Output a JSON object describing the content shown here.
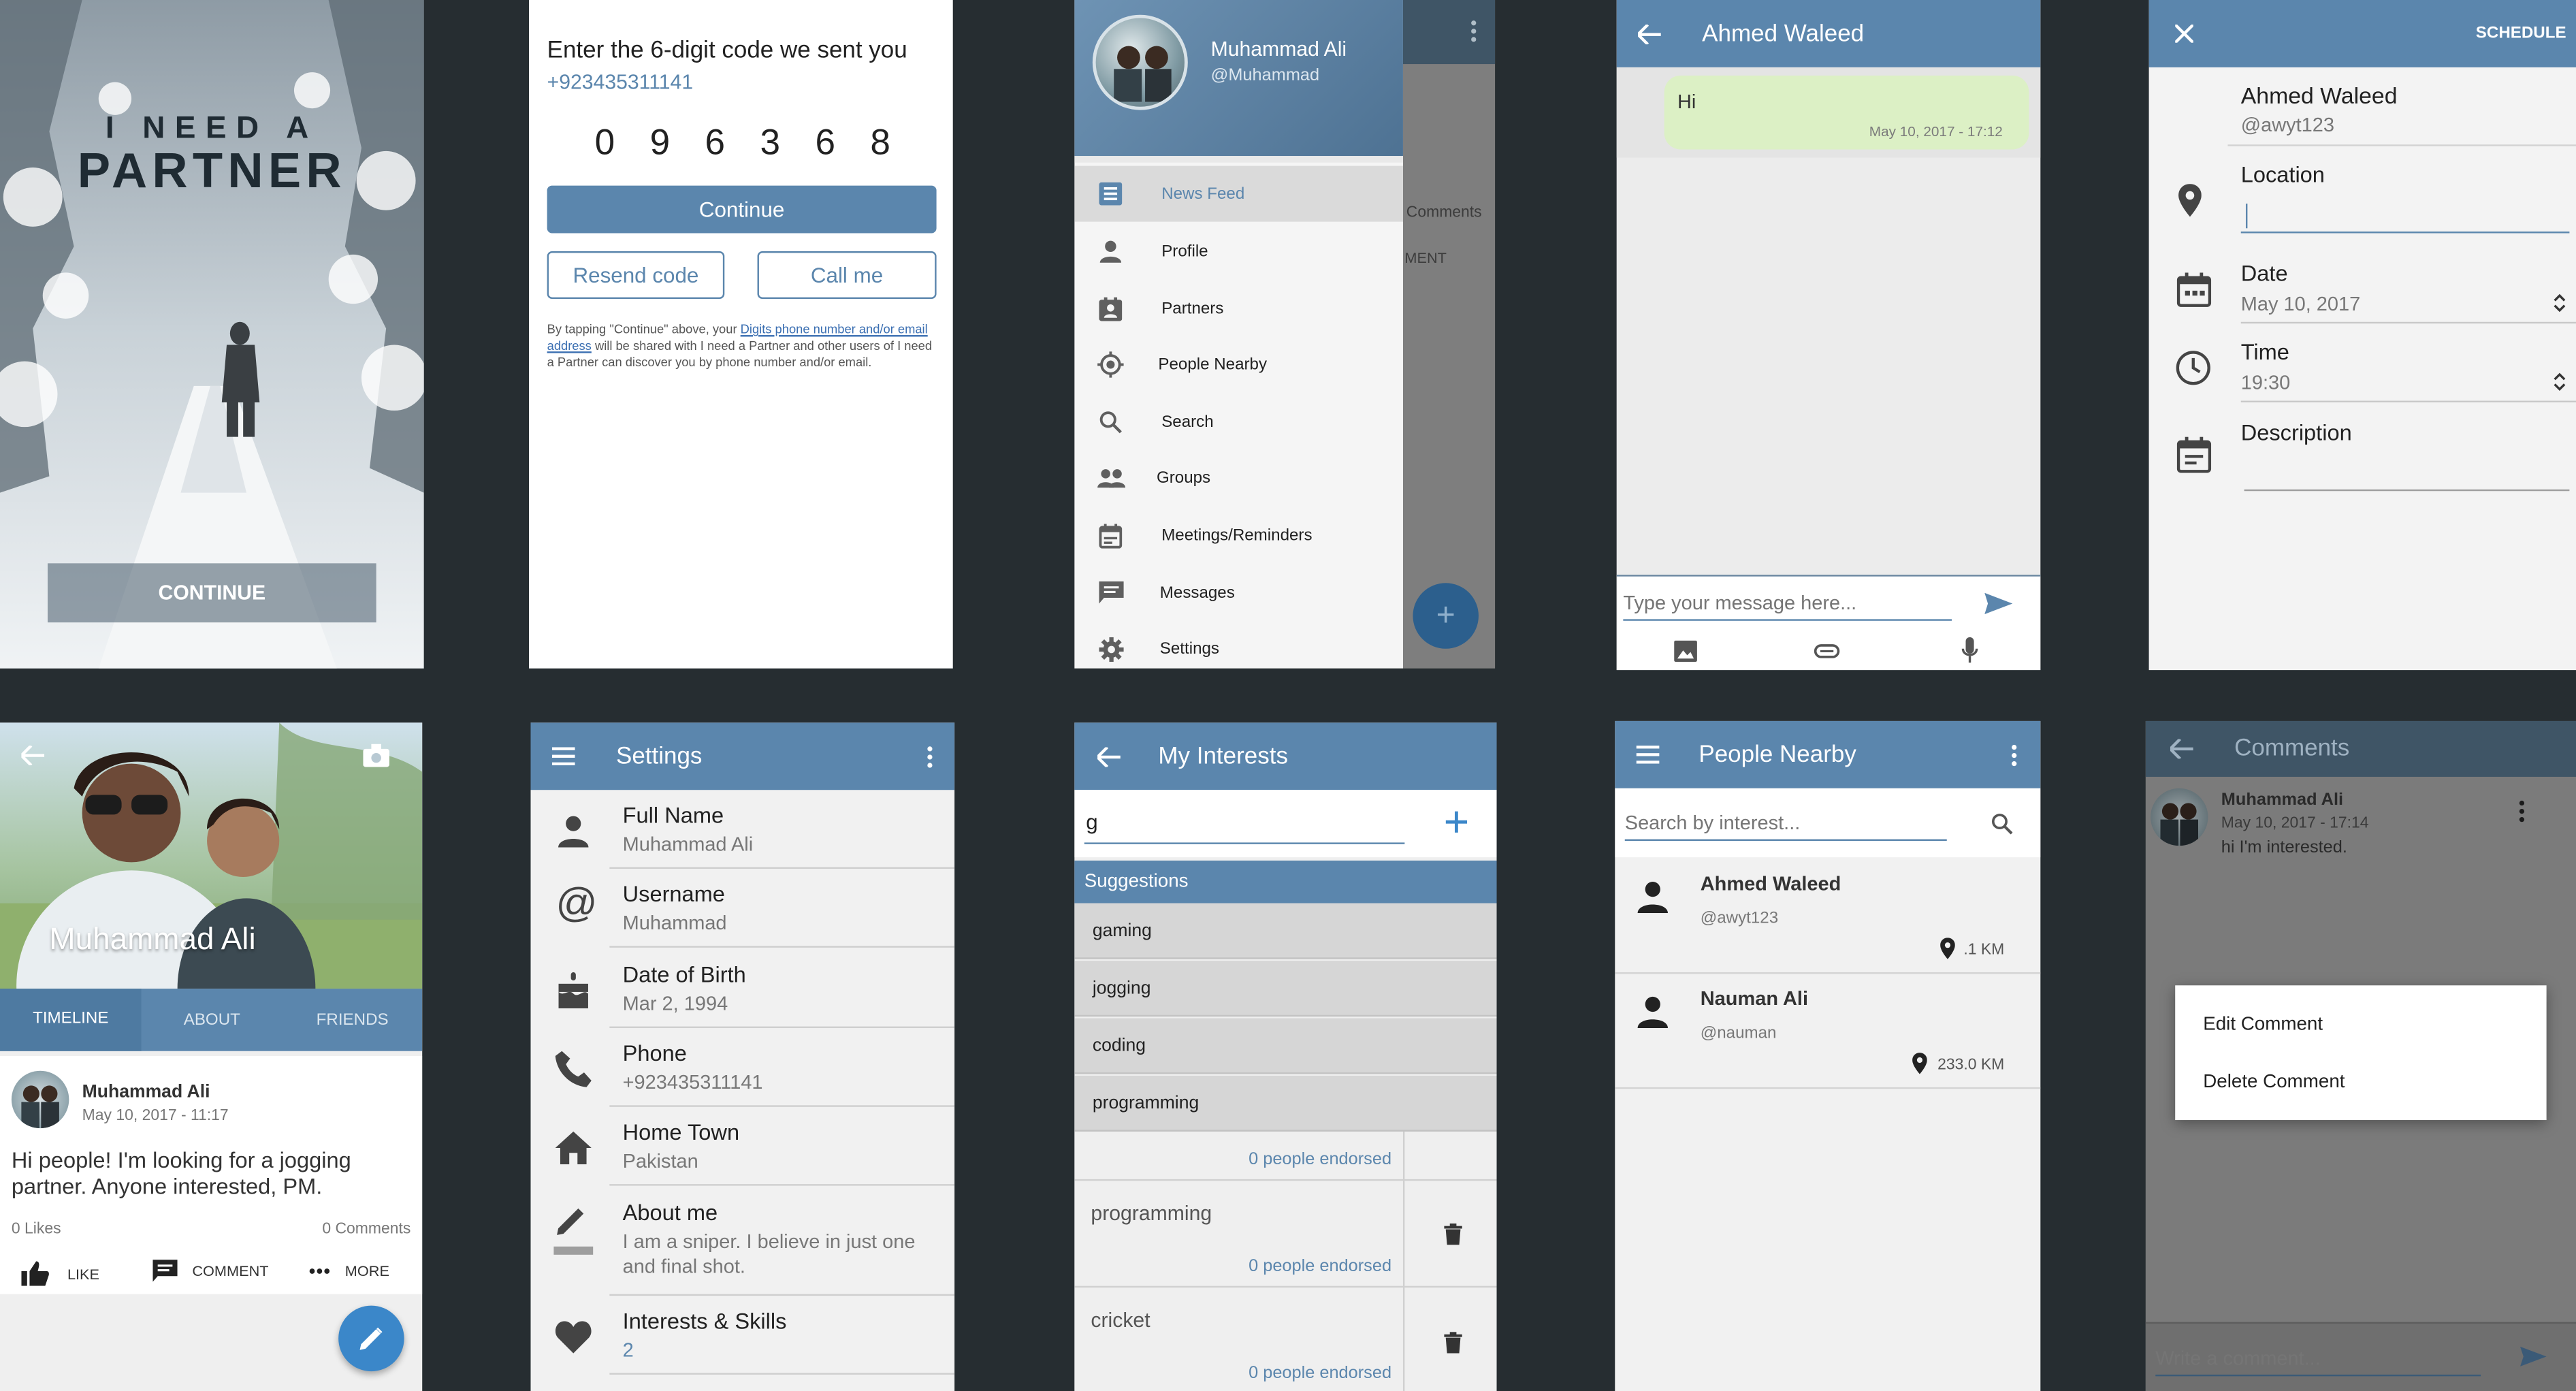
{
  "splash": {
    "logo_line1": "I NEED A",
    "logo_line2": "PARTNER",
    "continue_label": "CONTINUE"
  },
  "verify": {
    "heading": "Enter the 6-digit code we sent you",
    "phone": "+923435311141",
    "code_digits": [
      "0",
      "9",
      "6",
      "3",
      "6",
      "8"
    ],
    "continue_label": "Continue",
    "resend_label": "Resend code",
    "call_label": "Call me",
    "disclaimer_pre": "By tapping \"Continue\" above, your ",
    "disclaimer_link": "Digits phone number and/or email address",
    "disclaimer_post": " will be shared with I need a Partner and other users of I need a Partner can discover you by phone number and/or email."
  },
  "drawer": {
    "user_name": "Muhammad Ali",
    "user_handle": "@Muhammad",
    "items": [
      {
        "label": "News Feed",
        "icon": "news-feed-icon"
      },
      {
        "label": "Profile",
        "icon": "person-icon"
      },
      {
        "label": "Partners",
        "icon": "contacts-icon"
      },
      {
        "label": "People Nearby",
        "icon": "location-target-icon"
      },
      {
        "label": "Search",
        "icon": "search-icon"
      },
      {
        "label": "Groups",
        "icon": "group-icon"
      },
      {
        "label": "Meetings/Reminders",
        "icon": "calendar-icon"
      },
      {
        "label": "Messages",
        "icon": "chat-icon"
      },
      {
        "label": "Settings",
        "icon": "gear-icon"
      }
    ],
    "behind_comments": "Comments",
    "behind_ment": "MENT"
  },
  "chat": {
    "title": "Ahmed Waleed",
    "message_text": "Hi",
    "message_time": "May 10, 2017 - 17:12",
    "input_placeholder": "Type your message here..."
  },
  "schedule": {
    "action_label": "SCHEDULE",
    "name": "Ahmed Waleed",
    "handle": "@awyt123",
    "location_label": "Location",
    "date_label": "Date",
    "date_value": "May 10, 2017",
    "time_label": "Time",
    "time_value": "19:30",
    "description_label": "Description"
  },
  "profile": {
    "name_overlay": "Muhammad Ali",
    "tabs": [
      "TIMELINE",
      "ABOUT",
      "FRIENDS"
    ],
    "post_author": "Muhammad Ali",
    "post_time": "May 10, 2017 - 11:17",
    "post_text": "Hi people! I'm looking for a jogging partner. Anyone interested, PM.",
    "likes": "0 Likes",
    "comments": "0 Comments",
    "like_label": "LIKE",
    "comment_label": "COMMENT",
    "more_label": "MORE"
  },
  "settings": {
    "title": "Settings",
    "rows": [
      {
        "label": "Full Name",
        "value": "Muhammad Ali",
        "icon": "person-icon"
      },
      {
        "label": "Username",
        "value": "Muhammad",
        "icon": "at-icon"
      },
      {
        "label": "Date of Birth",
        "value": "Mar 2, 1994",
        "icon": "cake-icon"
      },
      {
        "label": "Phone",
        "value": "+923435311141",
        "icon": "phone-icon"
      },
      {
        "label": "Home Town",
        "value": "Pakistan",
        "icon": "home-icon"
      },
      {
        "label": "About me",
        "value": "I am a sniper. I believe in just one and final shot.",
        "icon": "edit-icon"
      },
      {
        "label": "Interests & Skills",
        "value": "2",
        "icon": "heart-icon"
      }
    ]
  },
  "interests": {
    "title": "My Interests",
    "input_value": "g",
    "suggestions_header": "Suggestions",
    "suggestions": [
      "gaming",
      "jogging",
      "coding",
      "programming"
    ],
    "endorsed_top": "0 people endorsed",
    "list": [
      {
        "name": "programming",
        "endorsed": "0 people endorsed"
      },
      {
        "name": "cricket",
        "endorsed": "0 people endorsed"
      }
    ]
  },
  "nearby": {
    "title": "People Nearby",
    "search_placeholder": "Search by interest...",
    "people": [
      {
        "name": "Ahmed Waleed",
        "handle": "@awyt123",
        "distance": ".1 KM"
      },
      {
        "name": "Nauman Ali",
        "handle": "@nauman",
        "distance": "233.0 KM"
      }
    ]
  },
  "comments": {
    "title": "Comments",
    "author": "Muhammad Ali",
    "time": "May 10, 2017 - 17:14",
    "text": "hi I'm interested.",
    "menu_edit": "Edit Comment",
    "menu_delete": "Delete Comment",
    "input_placeholder": "Write a comment..."
  },
  "colors": {
    "primary": "#5b86ad",
    "accent": "#3b87c9",
    "background": "#262d31",
    "chat_bubble": "#dcf0c5"
  }
}
